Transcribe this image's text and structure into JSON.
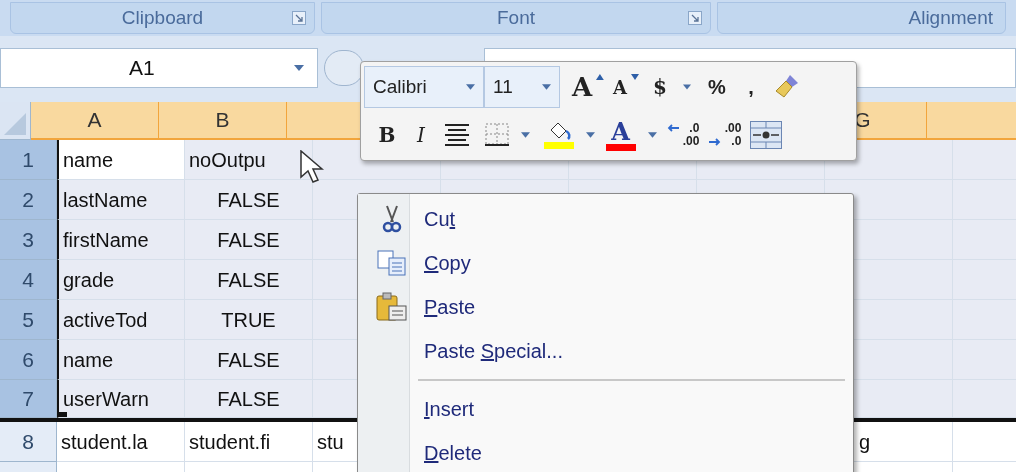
{
  "ribbon_groups": [
    {
      "label": "Clipboard",
      "launcher": true
    },
    {
      "label": "Font",
      "launcher": true
    },
    {
      "label": "Alignment",
      "launcher": false
    }
  ],
  "name_box": {
    "value": "A1"
  },
  "columns": [
    {
      "kind": "header",
      "label": "A",
      "selected": true
    },
    {
      "kind": "header",
      "label": "B",
      "selected": true
    },
    {
      "kind": "header",
      "selected": true
    },
    {
      "kind": "covered"
    },
    {
      "kind": "covered"
    },
    {
      "kind": "covered"
    },
    {
      "kind": "header",
      "label": "G",
      "selected": true
    },
    {
      "kind": "header",
      "selected": true
    }
  ],
  "rows": [
    {
      "header": "1",
      "selected": true,
      "cells": [
        {
          "text": "name",
          "kind": "text",
          "active": true
        },
        {
          "text": "noOutpu",
          "kind": "text",
          "active": false
        }
      ]
    },
    {
      "header": "2",
      "selected": true,
      "cells": [
        {
          "text": "lastName",
          "kind": "text",
          "active": false
        },
        {
          "text": "FALSE",
          "kind": "boolean",
          "active": false
        }
      ]
    },
    {
      "header": "3",
      "selected": true,
      "cells": [
        {
          "text": "firstName",
          "kind": "text",
          "active": false
        },
        {
          "text": "FALSE",
          "kind": "boolean",
          "active": false
        }
      ]
    },
    {
      "header": "4",
      "selected": true,
      "cells": [
        {
          "text": "grade",
          "kind": "text",
          "active": false
        },
        {
          "text": "FALSE",
          "kind": "boolean",
          "active": false
        }
      ]
    },
    {
      "header": "5",
      "selected": true,
      "cells": [
        {
          "text": "activeTod",
          "kind": "text",
          "active": false
        },
        {
          "text": "TRUE",
          "kind": "boolean",
          "active": false
        }
      ]
    },
    {
      "header": "6",
      "selected": true,
      "cells": [
        {
          "text": "name",
          "kind": "text",
          "active": false
        },
        {
          "text": "FALSE",
          "kind": "boolean",
          "active": false
        }
      ]
    },
    {
      "header": "7",
      "selected": true,
      "cells": [
        {
          "text": "userWarn",
          "kind": "text",
          "active": false
        },
        {
          "text": "FALSE",
          "kind": "boolean",
          "active": false
        }
      ]
    },
    {
      "header": "8",
      "selected": false,
      "cells": [
        {
          "text": "student.la",
          "kind": "text",
          "active": false
        },
        {
          "text": "student.fi",
          "kind": "text",
          "active": false
        },
        {
          "text": "stu",
          "kind": "text",
          "active": false
        }
      ],
      "spill": {
        "text": "g"
      }
    },
    {
      "selected": false,
      "cells": []
    }
  ],
  "mini_toolbar": {
    "font": {
      "value": "Calibri"
    },
    "size": {
      "value": "11"
    },
    "row_1": [
      {
        "kind": "grow",
        "label": "A"
      },
      {
        "kind": "shrink",
        "label": "A"
      },
      {
        "kind": "dropdown",
        "label": "$"
      },
      {
        "kind": "text",
        "label": "%"
      },
      {
        "kind": "text",
        "label": ","
      },
      {
        "kind": "painter"
      }
    ],
    "row_2": [
      {
        "kind": "bold",
        "label": "B"
      },
      {
        "kind": "italic",
        "label": "I"
      },
      {
        "kind": "center"
      },
      {
        "kind": "borders"
      },
      {
        "kind": "fill",
        "color": "#ffff00"
      },
      {
        "kind": "font_color",
        "label": "A",
        "color": "#ff0000"
      },
      {
        "kind": "inc_decimal",
        "top": ".0",
        "bottom": ".00"
      },
      {
        "kind": "dec_decimal",
        "top": ".00",
        "bottom": ".0"
      },
      {
        "kind": "merge"
      }
    ]
  },
  "context_menu": [
    {
      "kind": "item",
      "before": "Cu",
      "key": "t"
    },
    {
      "kind": "item",
      "key": "C",
      "after": "opy"
    },
    {
      "kind": "item",
      "key": "P",
      "after": "aste"
    },
    {
      "kind": "item",
      "before": "Paste ",
      "key": "S",
      "after": "pecial..."
    },
    {
      "kind": "separator"
    },
    {
      "kind": "item",
      "key": "I",
      "after": "nsert"
    },
    {
      "kind": "item",
      "key": "D",
      "after": "elete"
    }
  ]
}
